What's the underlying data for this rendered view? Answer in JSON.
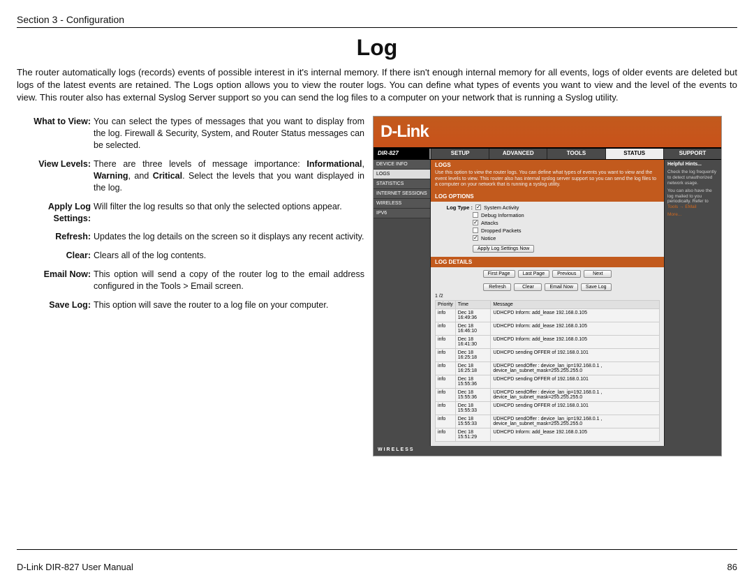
{
  "doc": {
    "section_header": "Section 3 - Configuration",
    "page_title": "Log",
    "intro": "The router automatically logs (records) events of possible interest in it's internal memory. If there isn't enough internal memory for all events, logs of older events are deleted but logs of the latest events are retained. The Logs option allows you to view the router logs. You can define what types of events you want to view and the level of the events to view. This router also has external Syslog Server support so you can send the log files to a computer on your network that is running a Syslog utility.",
    "footer_left": "D-Link DIR-827 User Manual",
    "footer_right": "86"
  },
  "defs": [
    {
      "term": "What to View:",
      "desc": "You can select the types of messages that you want to display from the log. Firewall & Security, System, and Router Status messages can be selected."
    },
    {
      "term": "View Levels:",
      "desc_html": "There are three levels of message importance: <b>Informational</b>, <b>Warning</b>, and <b>Critical</b>. Select the levels that you want displayed in the log."
    },
    {
      "term": "Apply Log Settings:",
      "desc": "Will filter the log results so that only the selected options appear."
    },
    {
      "term": "Refresh:",
      "desc": "Updates the log details on the screen so it displays any recent activity."
    },
    {
      "term": "Clear:",
      "desc": "Clears all of the log contents."
    },
    {
      "term": "Email Now:",
      "desc": "This option will send a copy of the router log to the email address configured in the Tools > Email screen."
    },
    {
      "term": "Save Log:",
      "desc": "This option will save the router to a log file on your computer."
    }
  ],
  "router": {
    "brand": "D-Link",
    "model": "DIR-827",
    "tabs": [
      "SETUP",
      "ADVANCED",
      "TOOLS",
      "STATUS",
      "SUPPORT"
    ],
    "tabs_active_index": 3,
    "sidenav": [
      "DEVICE INFO",
      "LOGS",
      "STATISTICS",
      "INTERNET SESSIONS",
      "WIRELESS",
      "IPV6"
    ],
    "sidenav_selected_index": 1,
    "logs": {
      "title": "LOGS",
      "desc": "Use this option to view the router logs. You can define what types of events you want to view and the event levels to view. This router also has internal syslog server support so you can send the log files to a computer on your network that is running a syslog utility.",
      "options_title": "LOG OPTIONS",
      "log_type_label": "Log Type :",
      "log_types": [
        {
          "label": "System Activity",
          "checked": true
        },
        {
          "label": "Debug Information",
          "checked": false
        },
        {
          "label": "Attacks",
          "checked": true
        },
        {
          "label": "Dropped Packets",
          "checked": false
        },
        {
          "label": "Notice",
          "checked": true
        }
      ],
      "apply_btn": "Apply Log Settings Now",
      "details_title": "LOG DETAILS",
      "buttons": [
        "First Page",
        "Last Page",
        "Previous",
        "Next",
        "Refresh",
        "Clear",
        "Email Now",
        "Save Log"
      ],
      "page_indicator": "1 /2",
      "columns": [
        "Priority",
        "Time",
        "Message"
      ],
      "rows": [
        [
          "info",
          "Dec 18 16:49:36",
          "UDHCPD Inform: add_lease 192.168.0.105"
        ],
        [
          "info",
          "Dec 18 16:46:10",
          "UDHCPD Inform: add_lease 192.168.0.105"
        ],
        [
          "info",
          "Dec 18 16:41:30",
          "UDHCPD Inform: add_lease 192.168.0.105"
        ],
        [
          "info",
          "Dec 18 16:25:18",
          "UDHCPD sending OFFER of 192.168.0.101"
        ],
        [
          "info",
          "Dec 18 16:25:18",
          "UDHCPD sendOffer : device_lan_ip=192.168.0.1 , device_lan_subnet_mask=255.255.255.0"
        ],
        [
          "info",
          "Dec 18 15:55:36",
          "UDHCPD sending OFFER of 192.168.0.101"
        ],
        [
          "info",
          "Dec 18 15:55:36",
          "UDHCPD sendOffer : device_lan_ip=192.168.0.1 , device_lan_subnet_mask=255.255.255.0"
        ],
        [
          "info",
          "Dec 18 15:55:33",
          "UDHCPD sending OFFER of 192.168.0.101"
        ],
        [
          "info",
          "Dec 18 15:55:33",
          "UDHCPD sendOffer : device_lan_ip=192.168.0.1 , device_lan_subnet_mask=255.255.255.0"
        ],
        [
          "info",
          "Dec 18 15:51:29",
          "UDHCPD Inform: add_lease 192.168.0.105"
        ]
      ]
    },
    "hints": {
      "title": "Helpful Hints...",
      "p1": "Check the log frequently to detect unauthorized network usage.",
      "p2_pre": "You can also have the log mailed to you periodically. Refer to ",
      "p2_link": "Tools → EMail",
      "more": "More..."
    },
    "footer": "WIRELESS"
  }
}
